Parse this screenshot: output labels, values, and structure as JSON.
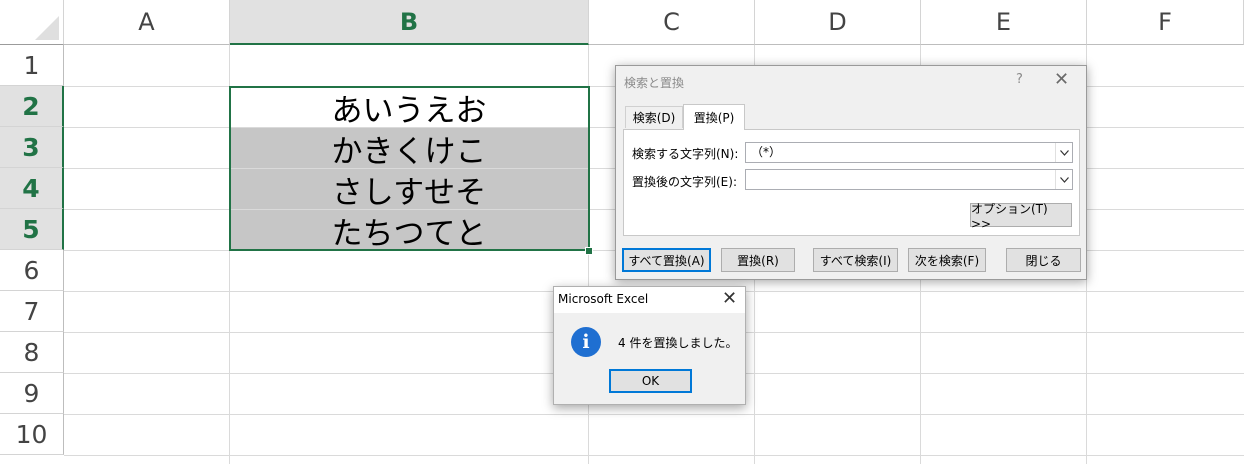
{
  "columns": [
    "A",
    "B",
    "C",
    "D",
    "E",
    "F"
  ],
  "selected_column": "B",
  "rows": [
    "1",
    "2",
    "3",
    "4",
    "5",
    "6",
    "7",
    "8",
    "9",
    "10"
  ],
  "selected_rows": [
    "2",
    "3",
    "4",
    "5"
  ],
  "cells": {
    "B2": "あいうえお",
    "B3": "かきくけこ",
    "B4": "さしすせそ",
    "B5": "たちつてと"
  },
  "colors": {
    "accent_green": "#217346",
    "filled_cell": "#c6c6c6",
    "focus_blue": "#0078d7",
    "info_icon": "#1f6fd1"
  },
  "find_replace_dialog": {
    "title": "検索と置換",
    "help": "?",
    "close": "✕",
    "tabs": [
      {
        "label": "検索(D)",
        "active": false
      },
      {
        "label": "置換(P)",
        "active": true
      }
    ],
    "find_label": "検索する文字列(N):",
    "find_value": "（*）",
    "replace_label": "置換後の文字列(E):",
    "replace_value": "",
    "options_button": "オプション(T) >>",
    "buttons": {
      "replace_all": "すべて置換(A)",
      "replace": "置換(R)",
      "find_all": "すべて検索(I)",
      "find_next": "次を検索(F)",
      "close": "閉じる"
    },
    "dropdown_icon": "chevron-down-icon"
  },
  "message_box": {
    "title": "Microsoft Excel",
    "close": "✕",
    "icon": "info-icon",
    "icon_glyph": "i",
    "message": "4 件を置換しました。",
    "ok": "OK"
  }
}
